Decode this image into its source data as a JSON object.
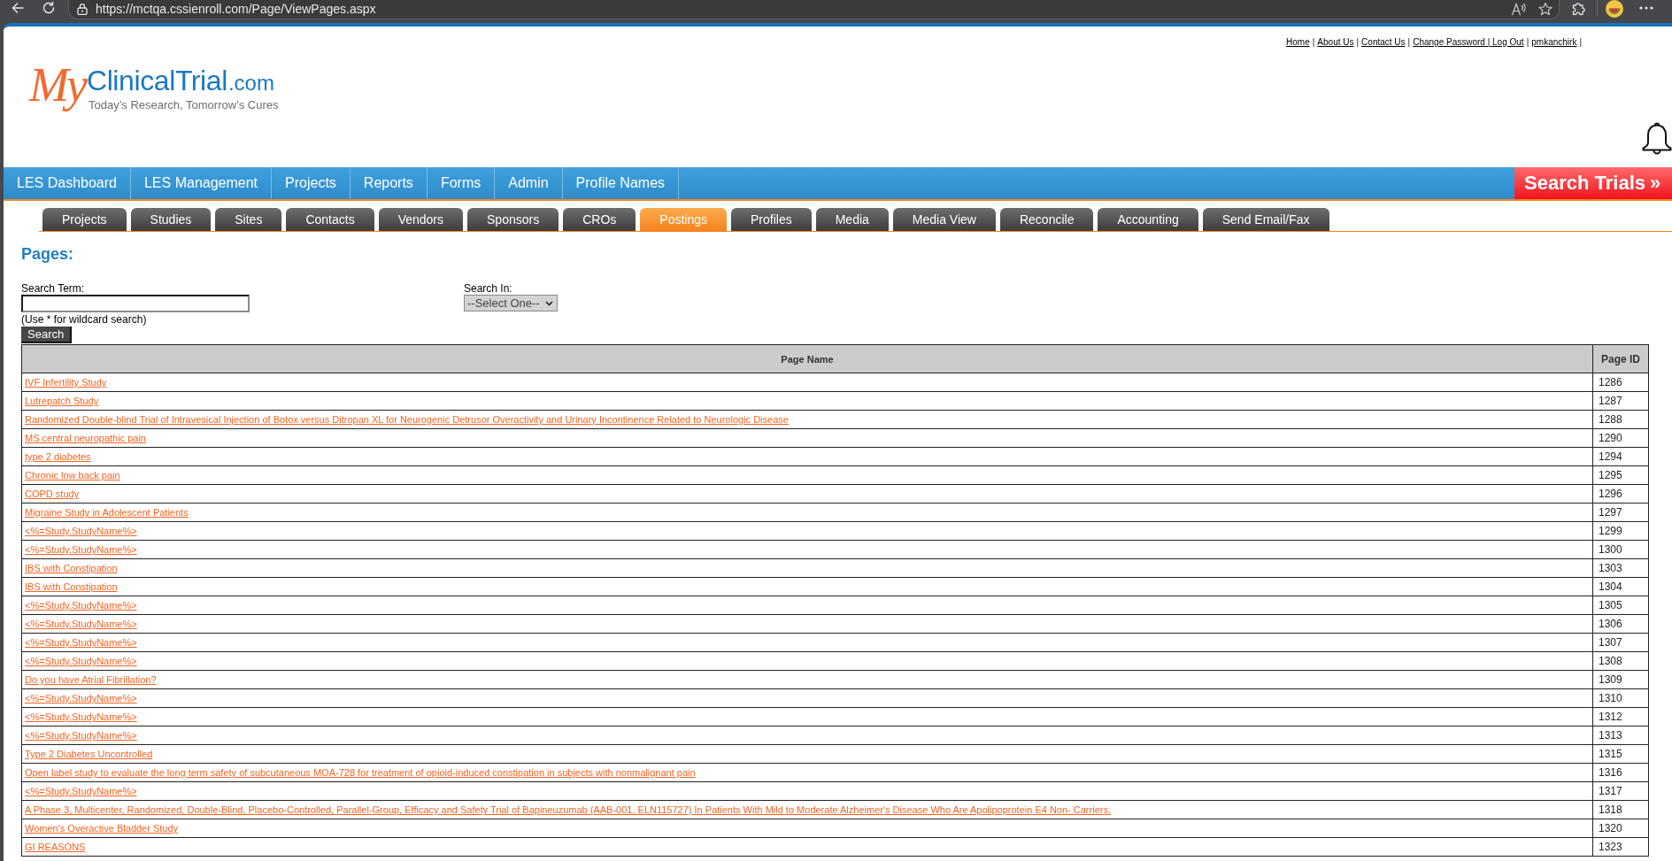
{
  "browser": {
    "url": "https://mctqa.cssienroll.com/Page/ViewPages.aspx"
  },
  "header": {
    "top_links": [
      {
        "label": "Home",
        "separator": "|"
      },
      {
        "label": "About Us",
        "separator": "|"
      },
      {
        "label": "Contact Us",
        "separator": "|"
      },
      {
        "label": "Change Password | Log Out",
        "separator": "|"
      },
      {
        "label": "pmkanchirk",
        "separator": "|"
      }
    ],
    "logo": {
      "script": "My",
      "name": "ClinicalTrial",
      "domain": ".com",
      "tagline": "Today’s Research, Tomorrow’s Cures"
    }
  },
  "main_nav": {
    "items": [
      "LES Dashboard",
      "LES Management",
      "Projects",
      "Reports",
      "Forms",
      "Admin",
      "Profile Names"
    ],
    "search_trials": {
      "label": "Search Trials",
      "arrow": "»"
    }
  },
  "sub_tabs": [
    {
      "label": "Projects",
      "selected": false
    },
    {
      "label": "Studies",
      "selected": false
    },
    {
      "label": "Sites",
      "selected": false
    },
    {
      "label": "Contacts",
      "selected": false
    },
    {
      "label": "Vendors",
      "selected": false
    },
    {
      "label": "Sponsors",
      "selected": false
    },
    {
      "label": "CROs",
      "selected": false
    },
    {
      "label": "Postings",
      "selected": true
    },
    {
      "label": "Profiles",
      "selected": false
    },
    {
      "label": "Media",
      "selected": false
    },
    {
      "label": "Media View",
      "selected": false
    },
    {
      "label": "Reconcile",
      "selected": false
    },
    {
      "label": "Accounting",
      "selected": false
    },
    {
      "label": "Send Email/Fax",
      "selected": false
    }
  ],
  "page_title": "Pages:",
  "search_form": {
    "search_term": {
      "label": "Search Term:",
      "note": "(Use * for wildcard search)"
    },
    "search_in": {
      "label": "Search In:",
      "value": "--Select One--"
    },
    "button": "Search"
  },
  "table": {
    "columns": [
      "Page Name",
      "Page ID"
    ],
    "rows": [
      {
        "page_name": "IVF Infertility Study",
        "page_id": "1286"
      },
      {
        "page_name": "Lutrepatch Study",
        "page_id": "1287"
      },
      {
        "page_name": "Randomized Double-blind Trial of Intravesical Injection of Botox versus Ditropan XL for Neurogenic Detrusor Overactivity and Urinary Incontinence Related to Neurologic Disease",
        "page_id": "1288"
      },
      {
        "page_name": "MS central neuropathic pain",
        "page_id": "1290"
      },
      {
        "page_name": "type 2 diabetes",
        "page_id": "1294"
      },
      {
        "page_name": "Chronic low back pain",
        "page_id": "1295"
      },
      {
        "page_name": "COPD study",
        "page_id": "1296"
      },
      {
        "page_name": "Migraine Study in Adolescent Patients",
        "page_id": "1297"
      },
      {
        "page_name": "<%=Study.StudyName%>",
        "page_id": "1299"
      },
      {
        "page_name": "<%=Study.StudyName%>",
        "page_id": "1300"
      },
      {
        "page_name": "IBS with Constipation",
        "page_id": "1303"
      },
      {
        "page_name": "IBS with Constipation",
        "page_id": "1304"
      },
      {
        "page_name": "<%=Study.StudyName%>",
        "page_id": "1305"
      },
      {
        "page_name": "<%=Study.StudyName%>",
        "page_id": "1306"
      },
      {
        "page_name": "<%=Study.StudyName%>",
        "page_id": "1307"
      },
      {
        "page_name": "<%=Study.StudyName%>",
        "page_id": "1308"
      },
      {
        "page_name": "Do you have Atrial Fibrillation?",
        "page_id": "1309"
      },
      {
        "page_name": "<%=Study.StudyName%>",
        "page_id": "1310"
      },
      {
        "page_name": "<%=Study.StudyName%>",
        "page_id": "1312"
      },
      {
        "page_name": "<%=Study.StudyName%>",
        "page_id": "1313"
      },
      {
        "page_name": "Type 2 Diabetes Uncontrolled",
        "page_id": "1315"
      },
      {
        "page_name": "Open label study to evaluate the long term safety of subcutaneous MOA-728 for treatment of opioid-induced constipation in subjects with nonmalignant pain",
        "page_id": "1316"
      },
      {
        "page_name": "<%=Study.StudyName%>",
        "page_id": "1317"
      },
      {
        "page_name": "A Phase 3, Multicenter, Randomized, Double-Blind, Placebo-Controlled, Parallel-Group, Efficacy and Safety Trial of Bapineuzumab (AAB-001, ELN115727) In Patients With Mild to Moderate Alzheimer's Disease Who Are Apolipoprotein E4 Non- Carriers.",
        "page_id": "1318"
      },
      {
        "page_name": "Women's Overactive Bladder Study",
        "page_id": "1320"
      },
      {
        "page_name": "GI REASONS",
        "page_id": "1323"
      }
    ]
  }
}
